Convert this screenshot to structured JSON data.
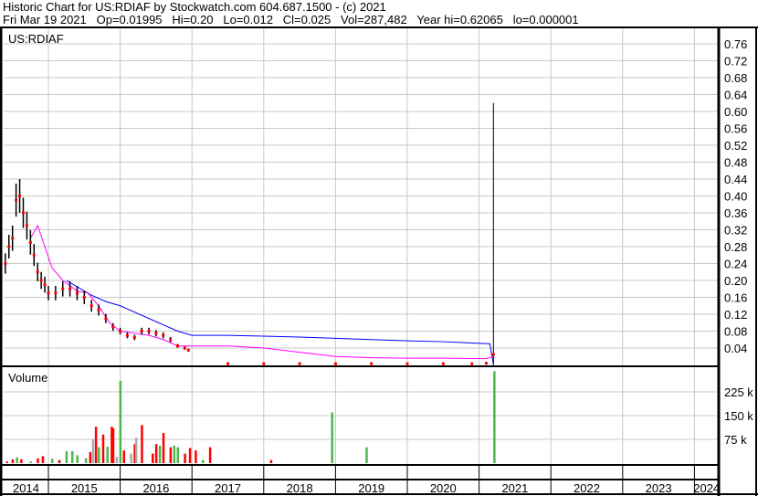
{
  "header": {
    "line1": "Historic Chart for US:RDIAF by Stockwatch.com 604.687.1500 - (c) 2021",
    "line2": "Fri Mar 19 2021   Op=0.01995   Hi=0.20   Lo=0.012   Cl=0.025   Vol=287,482   Year hi=0.62065   lo=0.000001"
  },
  "chart_data": [
    {
      "type": "line",
      "title": "US:RDIAF",
      "ylim": [
        0,
        0.78
      ],
      "y_ticks": [
        "0.04",
        "0.08",
        "0.12",
        "0.16",
        "0.20",
        "0.24",
        "0.28",
        "0.32",
        "0.36",
        "0.40",
        "0.44",
        "0.48",
        "0.52",
        "0.56",
        "0.60",
        "0.64",
        "0.68",
        "0.72",
        "0.76"
      ],
      "x_ticks": [
        "2014",
        "2015",
        "2016",
        "2017",
        "2018",
        "2019",
        "2020",
        "2021",
        "2022",
        "2023",
        "2024"
      ],
      "colors": {
        "price": "#ff0000",
        "bars": "#000000",
        "ma_short": "#ff00ff",
        "ma_long": "#0000ff"
      },
      "series": [
        {
          "name": "close",
          "x": [
            2014.4,
            2014.45,
            2014.5,
            2014.55,
            2014.6,
            2014.65,
            2014.7,
            2014.75,
            2014.8,
            2014.85,
            2014.9,
            2014.95,
            2015.0,
            2015.1,
            2015.2,
            2015.3,
            2015.4,
            2015.5,
            2015.6,
            2015.7,
            2015.8,
            2015.9,
            2016.0,
            2016.1,
            2016.2,
            2016.3,
            2016.4,
            2016.5,
            2016.6,
            2016.7,
            2016.8,
            2016.9,
            2016.95,
            2017.5,
            2018.0,
            2018.5,
            2019.0,
            2019.5,
            2020.0,
            2020.5,
            2020.9,
            2021.1,
            2021.2
          ],
          "y": [
            0.24,
            0.28,
            0.3,
            0.39,
            0.4,
            0.36,
            0.33,
            0.29,
            0.26,
            0.22,
            0.2,
            0.19,
            0.17,
            0.17,
            0.18,
            0.18,
            0.17,
            0.16,
            0.14,
            0.13,
            0.11,
            0.09,
            0.08,
            0.07,
            0.065,
            0.08,
            0.08,
            0.075,
            0.07,
            0.06,
            0.045,
            0.04,
            0.035,
            0.003,
            0.003,
            0.003,
            0.003,
            0.003,
            0.003,
            0.003,
            0.003,
            0.004,
            0.025
          ]
        },
        {
          "name": "ma_short",
          "x": [
            2014.75,
            2014.85,
            2014.95,
            2015.05,
            2015.2,
            2015.4,
            2015.55,
            2015.7,
            2015.85,
            2016.0,
            2016.2,
            2016.4,
            2016.6,
            2016.8,
            2017.0,
            2017.5,
            2018.0,
            2018.5,
            2019.0,
            2019.5,
            2020.0,
            2020.5,
            2021.1,
            2021.2
          ],
          "y": [
            0.3,
            0.33,
            0.28,
            0.23,
            0.2,
            0.175,
            0.17,
            0.14,
            0.1,
            0.08,
            0.075,
            0.07,
            0.06,
            0.045,
            0.045,
            0.045,
            0.04,
            0.03,
            0.02,
            0.017,
            0.016,
            0.016,
            0.015,
            0.02
          ]
        },
        {
          "name": "ma_long",
          "x": [
            2015.25,
            2015.4,
            2015.6,
            2015.8,
            2016.0,
            2016.2,
            2016.4,
            2016.6,
            2016.8,
            2017.0,
            2017.5,
            2018.0,
            2018.5,
            2019.0,
            2019.5,
            2020.0,
            2020.5,
            2021.15,
            2021.2
          ],
          "y": [
            0.2,
            0.185,
            0.165,
            0.15,
            0.14,
            0.125,
            0.11,
            0.095,
            0.08,
            0.07,
            0.07,
            0.068,
            0.066,
            0.063,
            0.06,
            0.057,
            0.055,
            0.05,
            0.0
          ]
        },
        {
          "name": "spike",
          "x": [
            2021.2,
            2021.2
          ],
          "y": [
            0.0,
            0.62
          ]
        }
      ]
    },
    {
      "type": "bar",
      "title": "Volume",
      "y_ticks": [
        "75 k",
        "150 k",
        "225 k"
      ],
      "ylim": [
        0,
        290000
      ],
      "colors": {
        "up": "#4cb84c",
        "down": "#ff0000",
        "flat": "#aaaaaa"
      },
      "bars": [
        [
          2014.42,
          5000,
          "down"
        ],
        [
          2014.5,
          12000,
          "down"
        ],
        [
          2014.56,
          18000,
          "up"
        ],
        [
          2014.62,
          12000,
          "down"
        ],
        [
          2014.75,
          5000,
          "up"
        ],
        [
          2014.85,
          15000,
          "down"
        ],
        [
          2014.92,
          22000,
          "down"
        ],
        [
          2015.05,
          14000,
          "up"
        ],
        [
          2015.15,
          10000,
          "down"
        ],
        [
          2015.25,
          38000,
          "up"
        ],
        [
          2015.33,
          38000,
          "up"
        ],
        [
          2015.4,
          25000,
          "up"
        ],
        [
          2015.52,
          15000,
          "up"
        ],
        [
          2015.58,
          35000,
          "down"
        ],
        [
          2015.62,
          75000,
          "flat"
        ],
        [
          2015.66,
          115000,
          "down"
        ],
        [
          2015.7,
          50000,
          "up"
        ],
        [
          2015.76,
          90000,
          "down"
        ],
        [
          2015.82,
          52000,
          "up"
        ],
        [
          2015.88,
          115000,
          "down"
        ],
        [
          2015.9,
          110000,
          "down"
        ],
        [
          2015.95,
          20000,
          "flat"
        ],
        [
          2016.0,
          260000,
          "up"
        ],
        [
          2016.05,
          40000,
          "down"
        ],
        [
          2016.15,
          30000,
          "flat"
        ],
        [
          2016.2,
          60000,
          "down"
        ],
        [
          2016.22,
          80000,
          "flat"
        ],
        [
          2016.3,
          120000,
          "down"
        ],
        [
          2016.45,
          30000,
          "down"
        ],
        [
          2016.5,
          60000,
          "down"
        ],
        [
          2016.55,
          55000,
          "up"
        ],
        [
          2016.6,
          95000,
          "down"
        ],
        [
          2016.7,
          50000,
          "down"
        ],
        [
          2016.75,
          55000,
          "up"
        ],
        [
          2016.8,
          50000,
          "up"
        ],
        [
          2016.9,
          30000,
          "down"
        ],
        [
          2016.97,
          48000,
          "down"
        ],
        [
          2017.05,
          40000,
          "down"
        ],
        [
          2017.15,
          10000,
          "up"
        ],
        [
          2017.25,
          50000,
          "down"
        ],
        [
          2018.1,
          10000,
          "down"
        ],
        [
          2018.95,
          160000,
          "up"
        ],
        [
          2019.43,
          50000,
          "up"
        ],
        [
          2021.21,
          290000,
          "up"
        ]
      ]
    }
  ]
}
